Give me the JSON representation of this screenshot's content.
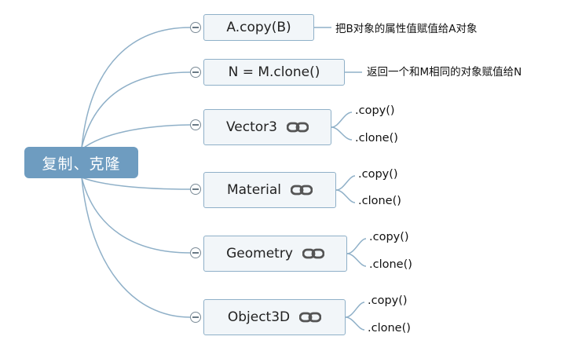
{
  "root": {
    "label": "复制、克隆"
  },
  "nodes": [
    {
      "label": "A.copy(B)",
      "note": "把B对象的属性值赋值给A对象",
      "has_link_icon": false
    },
    {
      "label": "N = M.clone()",
      "note": "返回一个和M相同的对象赋值给N",
      "has_link_icon": false
    },
    {
      "label": "Vector3",
      "has_link_icon": true,
      "children": [
        ".copy()",
        ".clone()"
      ]
    },
    {
      "label": "Material",
      "has_link_icon": true,
      "children": [
        ".copy()",
        ".clone()"
      ]
    },
    {
      "label": "Geometry",
      "has_link_icon": true,
      "children": [
        ".copy()",
        ".clone()"
      ]
    },
    {
      "label": "Object3D",
      "has_link_icon": true,
      "children": [
        ".copy()",
        ".clone()"
      ]
    }
  ],
  "colors": {
    "root_fill": "#6e9cc0",
    "node_fill": "#f2f6f9",
    "node_border": "#8fb0c8",
    "line": "#8fb0c8"
  },
  "icons": {
    "collapse": "minus-circle-icon",
    "link": "link-icon"
  }
}
